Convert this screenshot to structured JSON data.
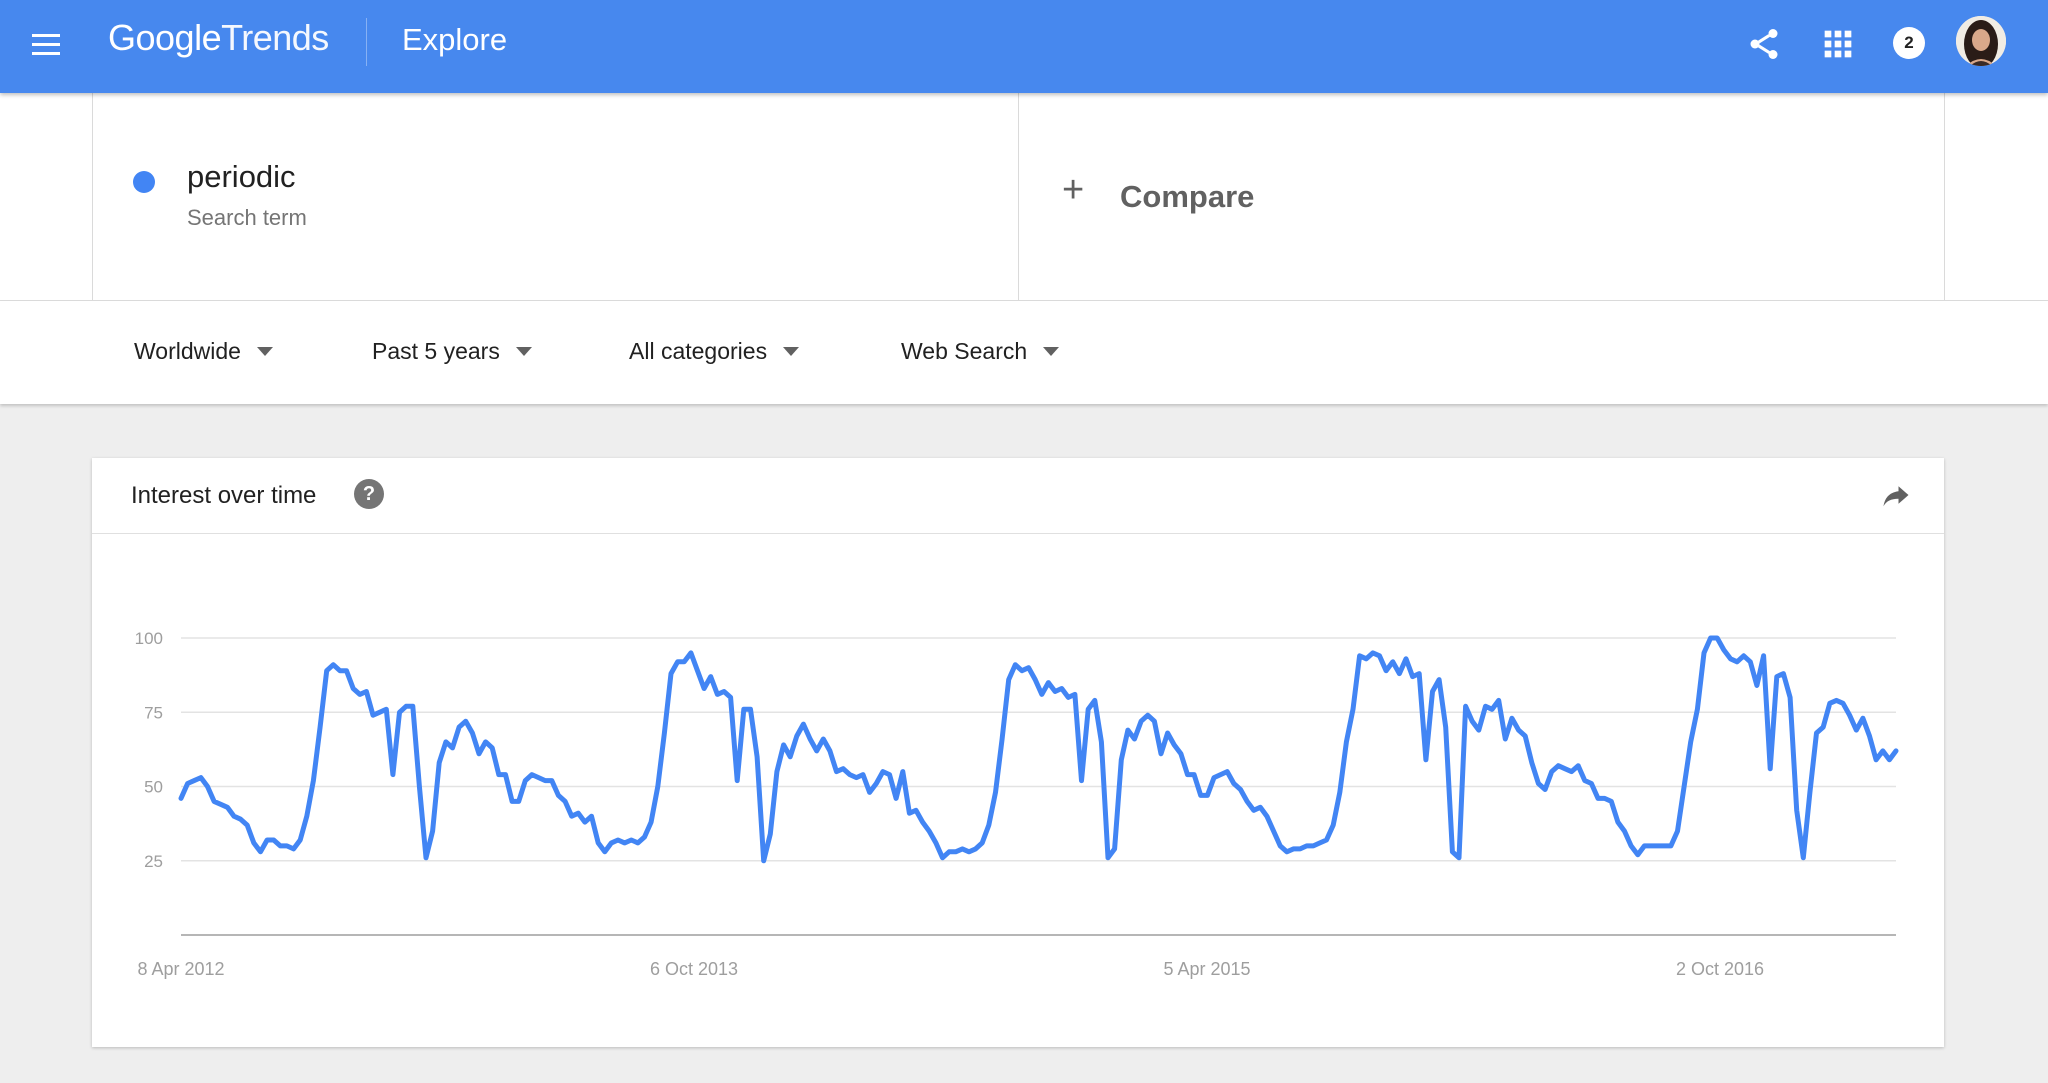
{
  "header": {
    "logo_google": "Google",
    "logo_trends": "Trends",
    "page_title": "Explore",
    "notification_count": "2",
    "brand_color": "#4788ee",
    "icons": [
      "menu-icon",
      "share-icon",
      "apps-icon",
      "avatar"
    ]
  },
  "search": {
    "term": "periodic",
    "term_type": "Search term",
    "term_color": "#4285f4",
    "compare_label": "Compare"
  },
  "filters": [
    {
      "label": "Worldwide"
    },
    {
      "label": "Past 5 years"
    },
    {
      "label": "All categories"
    },
    {
      "label": "Web Search"
    }
  ],
  "card": {
    "title": "Interest over time",
    "help": "?"
  },
  "chart_data": {
    "type": "line",
    "title": "Interest over time",
    "xlabel": "",
    "ylabel": "",
    "ylim": [
      0,
      100
    ],
    "yticks": [
      25,
      50,
      75,
      100
    ],
    "xtick_labels": [
      "8 Apr 2012",
      "6 Oct 2013",
      "5 Apr 2015",
      "2 Oct 2016"
    ],
    "grid": true,
    "line_color": "#4285f4",
    "series": [
      {
        "values": [
          46,
          51,
          52,
          53,
          50,
          45,
          44,
          43,
          40,
          39,
          37,
          31,
          28,
          32,
          32,
          30,
          30,
          29,
          32,
          40,
          52,
          70,
          89,
          91,
          89,
          89,
          83,
          81,
          82,
          74,
          75,
          76,
          54,
          75,
          77,
          77,
          50,
          26,
          35,
          58,
          65,
          63,
          70,
          72,
          68,
          61,
          65,
          63,
          54,
          54,
          45,
          45,
          52,
          54,
          53,
          52,
          52,
          47,
          45,
          40,
          41,
          38,
          40,
          31,
          28,
          31,
          32,
          31,
          32,
          31,
          33,
          38,
          50,
          68,
          88,
          92,
          92,
          95,
          89,
          83,
          87,
          81,
          82,
          80,
          52,
          76,
          76,
          60,
          25,
          34,
          55,
          64,
          60,
          67,
          71,
          66,
          62,
          66,
          62,
          55,
          56,
          54,
          53,
          54,
          48,
          51,
          55,
          54,
          46,
          55,
          41,
          42,
          38,
          35,
          31,
          26,
          28,
          28,
          29,
          28,
          29,
          31,
          37,
          48,
          66,
          86,
          91,
          89,
          90,
          86,
          81,
          85,
          82,
          83,
          80,
          81,
          52,
          76,
          79,
          65,
          26,
          29,
          59,
          69,
          66,
          72,
          74,
          72,
          61,
          68,
          64,
          61,
          54,
          54,
          47,
          47,
          53,
          54,
          55,
          51,
          49,
          45,
          42,
          43,
          40,
          35,
          30,
          28,
          29,
          29,
          30,
          30,
          31,
          32,
          37,
          48,
          65,
          76,
          94,
          93,
          95,
          94,
          89,
          92,
          88,
          93,
          87,
          88,
          59,
          82,
          86,
          70,
          28,
          26,
          77,
          72,
          69,
          77,
          76,
          79,
          66,
          73,
          69,
          67,
          58,
          51,
          49,
          55,
          57,
          56,
          55,
          57,
          52,
          51,
          46,
          46,
          45,
          38,
          35,
          30,
          27,
          30,
          30,
          30,
          30,
          30,
          35,
          50,
          65,
          76,
          95,
          100,
          100,
          96,
          93,
          92,
          94,
          92,
          84,
          94,
          56,
          87,
          88,
          80,
          42,
          26,
          48,
          68,
          70,
          78,
          79,
          78,
          74,
          69,
          73,
          67,
          59,
          62,
          59,
          62
        ]
      }
    ]
  }
}
